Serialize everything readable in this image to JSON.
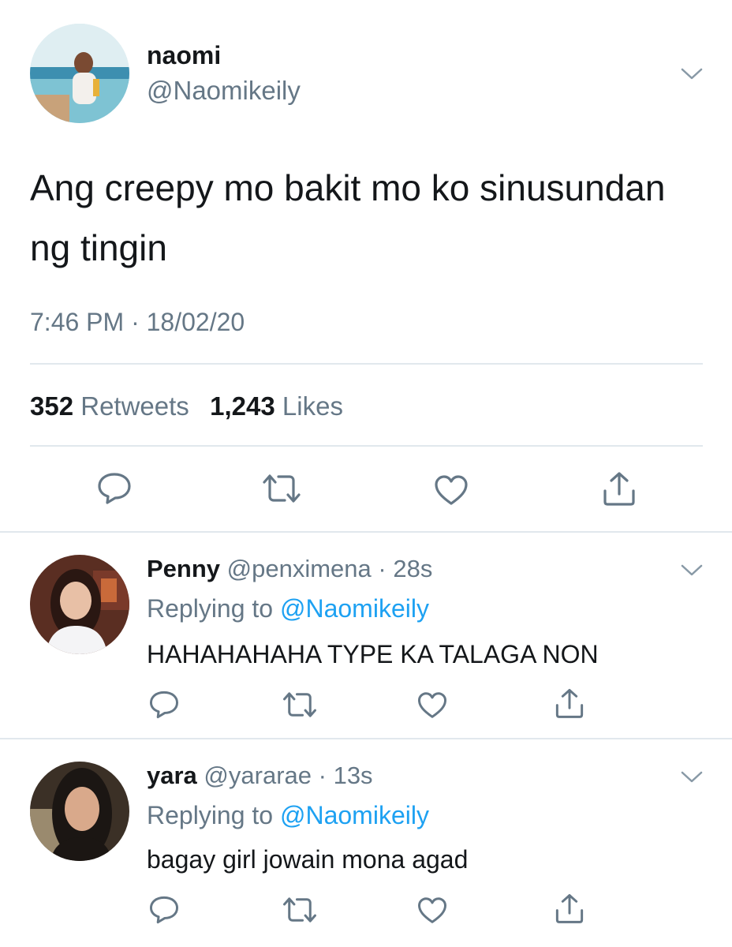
{
  "main_tweet": {
    "display_name": "naomi",
    "handle": "@Naomikeily",
    "text": "Ang creepy mo bakit mo ko sinusundan ng tingin",
    "timestamp": "7:46 PM · 18/02/20",
    "retweets_count": "352",
    "retweets_label": "Retweets",
    "likes_count": "1,243",
    "likes_label": "Likes",
    "actions": [
      "reply-icon",
      "retweet-icon",
      "like-icon",
      "share-icon"
    ]
  },
  "replies": [
    {
      "display_name": "Penny",
      "handle": "@penximena",
      "time": "· 28s",
      "replying_prefix": "Replying to",
      "replying_to": "@Naomikeily",
      "text": "HAHAHAHAHA TYPE KA TALAGA NON"
    },
    {
      "display_name": "yara",
      "handle": "@yararae",
      "time": "· 13s",
      "replying_prefix": "Replying to",
      "replying_to": "@Naomikeily",
      "text": "bagay girl jowain mona agad"
    }
  ],
  "colors": {
    "primary_text": "#14171a",
    "secondary_text": "#657786",
    "link": "#1da1f2",
    "divider": "#e1e8ed",
    "icon": "#657786"
  }
}
